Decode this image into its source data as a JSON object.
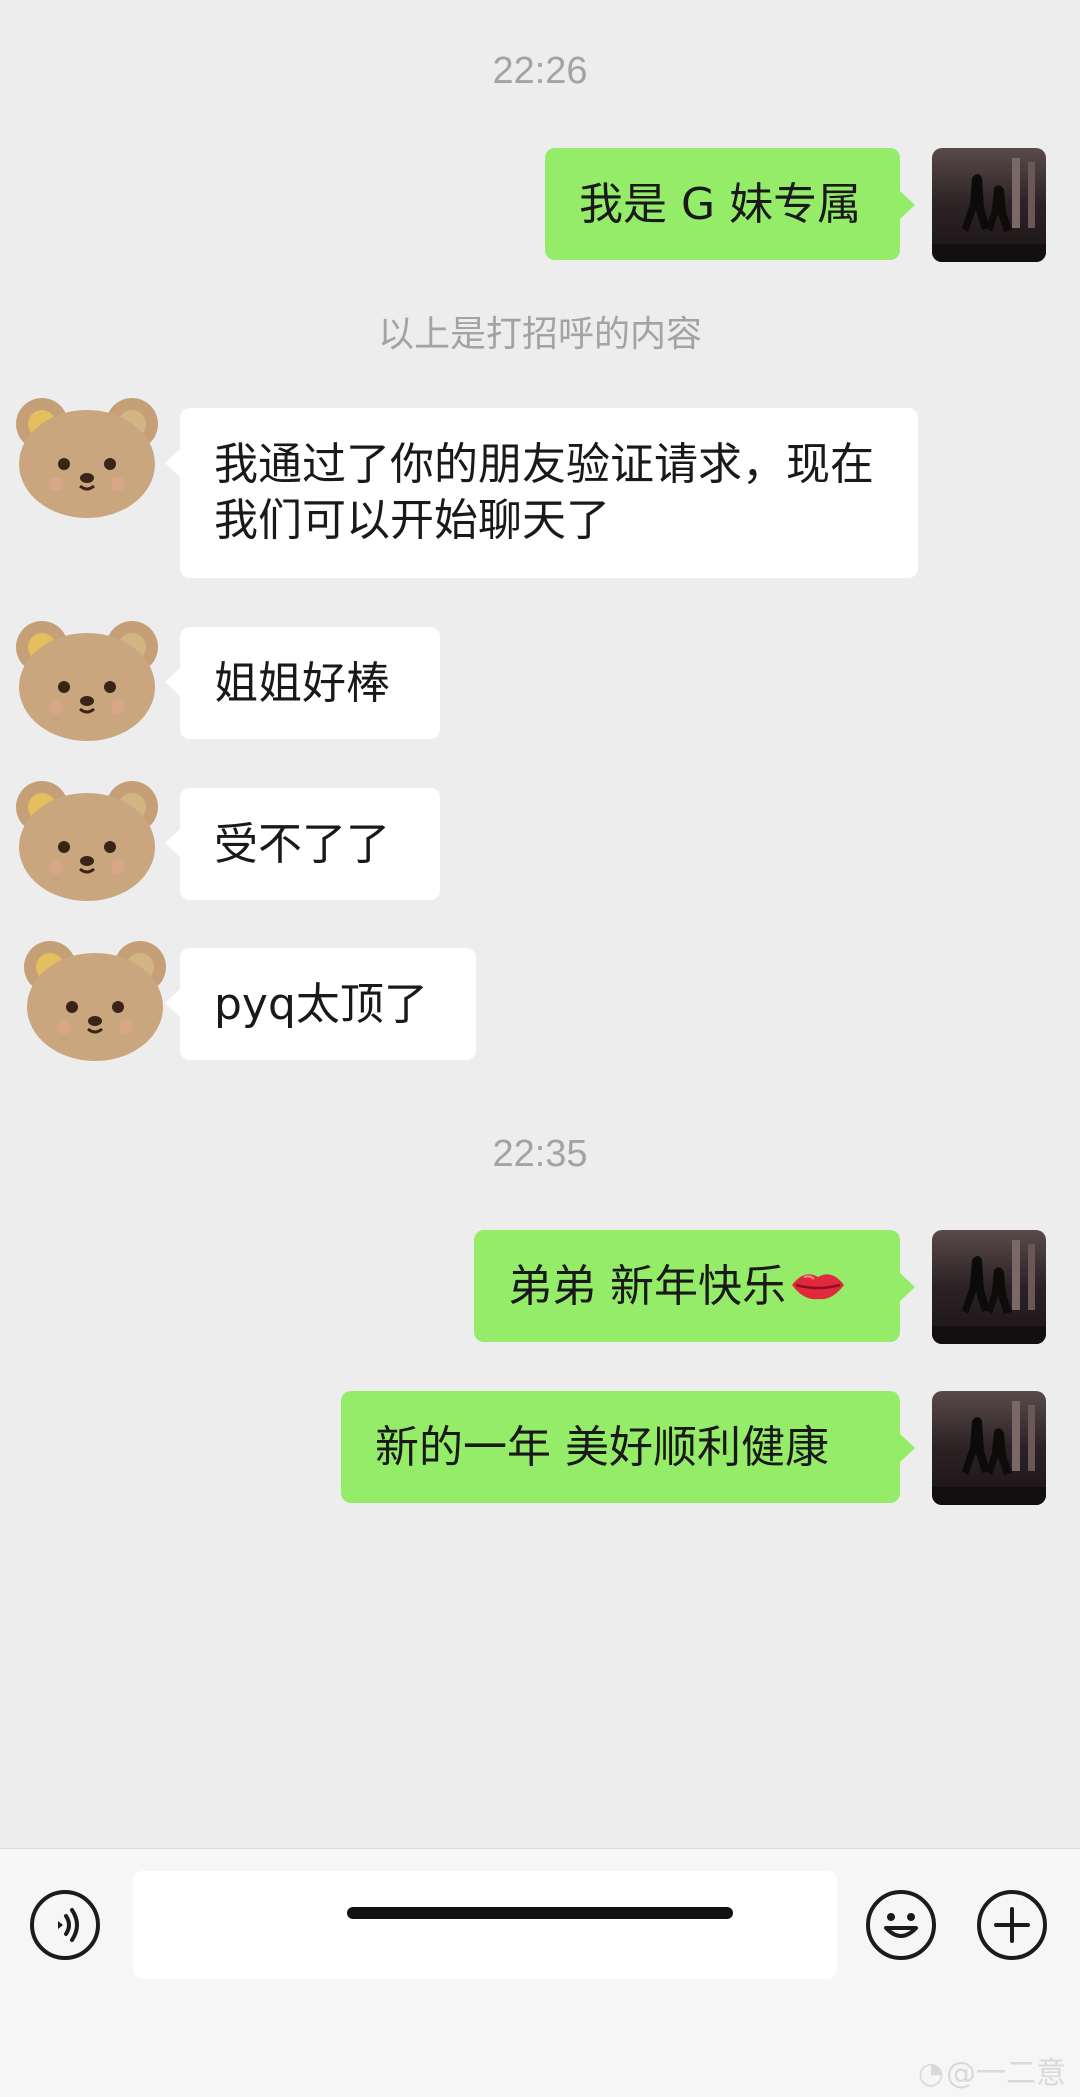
{
  "messages": {
    "time_1": "22:26",
    "out_1": "我是 G 妹专属",
    "system_note": "以上是打招呼的内容",
    "in_1": "我通过了你的朋友验证请求，现在我们可以开始聊天了",
    "in_2": "姐姐好棒",
    "in_3": "受不了了",
    "in_4": "pyq太顶了",
    "time_2": "22:35",
    "out_2": "弟弟 新年快乐",
    "out_2_emoji": "lips-emoji",
    "out_3": "新的一年 美好顺利健康"
  },
  "input": {
    "placeholder": "",
    "voice_icon": "voice-icon",
    "emoji_icon": "smiley-icon",
    "more_icon": "plus-icon"
  },
  "watermark": {
    "text": "@一二意",
    "icon": "weibo-icon"
  },
  "colors": {
    "background": "#ededed",
    "outgoing_bubble": "#95ec69",
    "incoming_bubble": "#ffffff",
    "timestamp": "#a3a3a3"
  }
}
